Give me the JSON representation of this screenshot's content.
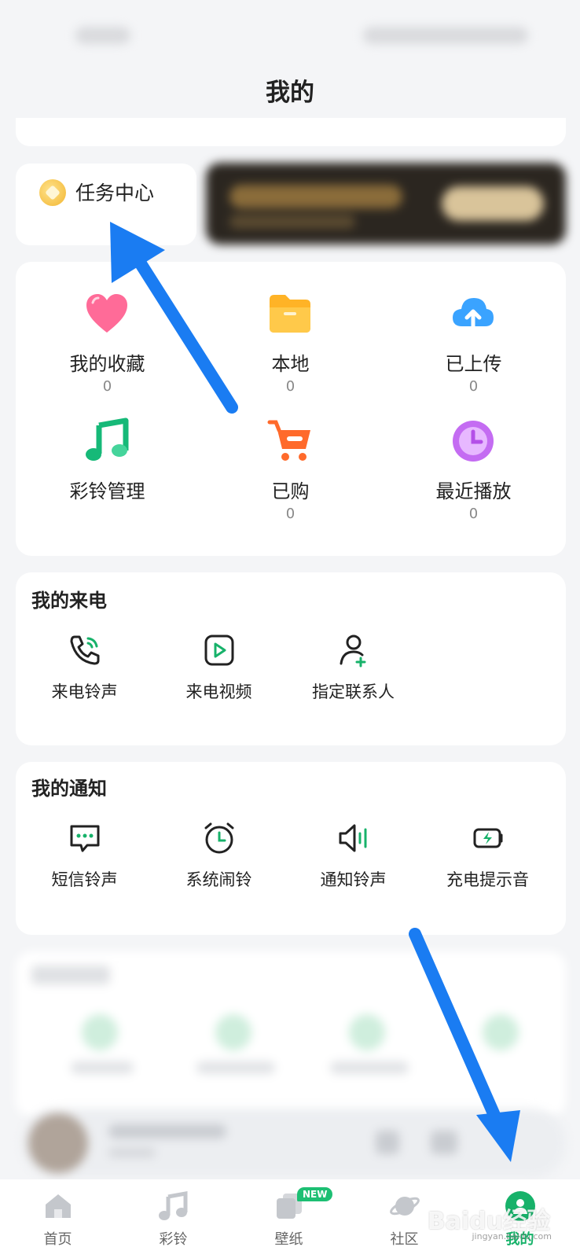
{
  "header": {
    "title": "我的"
  },
  "task_center": {
    "label": "任务中心"
  },
  "library": {
    "items": [
      {
        "label": "我的收藏",
        "count": "0",
        "icon": "heart-icon"
      },
      {
        "label": "本地",
        "count": "0",
        "icon": "folder-icon"
      },
      {
        "label": "已上传",
        "count": "0",
        "icon": "cloud-upload-icon"
      },
      {
        "label": "彩铃管理",
        "count": "",
        "icon": "music-note-icon"
      },
      {
        "label": "已购",
        "count": "0",
        "icon": "cart-icon"
      },
      {
        "label": "最近播放",
        "count": "0",
        "icon": "clock-icon"
      }
    ]
  },
  "incoming_call": {
    "title": "我的来电",
    "items": [
      {
        "label": "来电铃声",
        "icon": "phone-ring-icon"
      },
      {
        "label": "来电视频",
        "icon": "video-play-icon"
      },
      {
        "label": "指定联系人",
        "icon": "add-contact-icon"
      }
    ]
  },
  "notifications": {
    "title": "我的通知",
    "items": [
      {
        "label": "短信铃声",
        "icon": "message-icon"
      },
      {
        "label": "系统闹铃",
        "icon": "alarm-clock-icon"
      },
      {
        "label": "通知铃声",
        "icon": "speaker-icon"
      },
      {
        "label": "充电提示音",
        "icon": "battery-charge-icon"
      }
    ]
  },
  "tabbar": {
    "tabs": [
      {
        "label": "首页",
        "icon": "home-icon",
        "active": false
      },
      {
        "label": "彩铃",
        "icon": "music-icon",
        "active": false
      },
      {
        "label": "壁纸",
        "icon": "wallpaper-icon",
        "active": false,
        "badge": "NEW"
      },
      {
        "label": "社区",
        "icon": "planet-icon",
        "active": false
      },
      {
        "label": "我的",
        "icon": "profile-icon",
        "active": true
      }
    ]
  },
  "watermark": {
    "text": "Baidu经验",
    "sub": "jingyan.baidu.com"
  },
  "colors": {
    "accent": "#17b26a",
    "arrow": "#1a7cf2",
    "card_bg": "#ffffff",
    "page_bg": "#f4f5f7"
  }
}
